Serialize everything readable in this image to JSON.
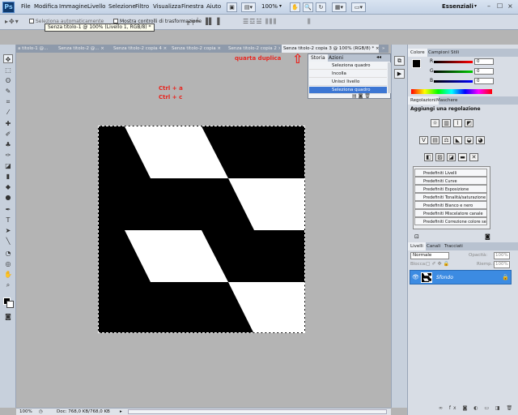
{
  "menubar": {
    "logo": "Ps",
    "items": [
      "File",
      "Modifica",
      "Immagine",
      "Livello",
      "Selezione",
      "Filtro",
      "Visualizza",
      "Finestra",
      "Aiuto"
    ],
    "zoom": "100%",
    "workspace": "Essenziali",
    "minimize": "–",
    "restore": "☐",
    "close": "×"
  },
  "options_bar": {
    "tooltip": "Senza titolo-1 @ 100% (Livello 1, RGB/8) *",
    "checkbox_label": "Seleziona automaticamente",
    "transform_label": "Mostra controlli di trasformazione"
  },
  "tabs": [
    {
      "label": "a titolo-1 @...",
      "active": false
    },
    {
      "label": "Senza titolo-2 @... ×",
      "active": false
    },
    {
      "label": "Senza titolo-2 copia 4 ×",
      "active": false
    },
    {
      "label": "Senza titolo-2 copia ×",
      "active": false
    },
    {
      "label": "Senza titolo-2 copia 2 ×",
      "active": false
    },
    {
      "label": "Senza titolo-2 copia 3 @ 100% (RGB/8) * ×",
      "active": true
    }
  ],
  "annotations": {
    "duplicate": "quarta duplica",
    "shortcut1": "Ctrl + a",
    "shortcut2": "Ctrl + c"
  },
  "history": {
    "tabs": [
      "Storia",
      "Azioni"
    ],
    "items": [
      {
        "label": "Seleziona quadro",
        "selected": false
      },
      {
        "label": "Incolla",
        "selected": false
      },
      {
        "label": "Unisci livello",
        "selected": false
      },
      {
        "label": "Seleziona quadro",
        "selected": true
      }
    ]
  },
  "color_panel": {
    "tabs": [
      "Colore",
      "Campioni",
      "Stili"
    ],
    "channels": [
      {
        "label": "R",
        "value": "0"
      },
      {
        "label": "G",
        "value": "0"
      },
      {
        "label": "B",
        "value": "0"
      }
    ]
  },
  "adjustments": {
    "tabs": [
      "Regolazioni",
      "Maschere"
    ],
    "title": "Aggiungi una regolazione",
    "presets": [
      "Predefiniti Livelli",
      "Predefiniti Curve",
      "Predefiniti Esposizione",
      "Predefiniti Tonalità/saturazione",
      "Predefiniti Bianco e nero",
      "Predefiniti Miscelatore canale",
      "Predefiniti Correzione colore sel..."
    ]
  },
  "layers": {
    "tabs": [
      "Livelli",
      "Canali",
      "Tracciati"
    ],
    "blend_mode": "Normale",
    "opacity_label": "Opacità:",
    "opacity_value": "100%",
    "lock_label": "Blocca:",
    "fill_label": "Riemp.:",
    "fill_value": "100%",
    "layer_name": "Sfondo"
  },
  "statusbar": {
    "zoom": "100%",
    "doc": "Doc: 768,0 KB/768,0 KB"
  },
  "colors": {
    "accent": "#3c76d3",
    "annotation": "#e8251f"
  }
}
